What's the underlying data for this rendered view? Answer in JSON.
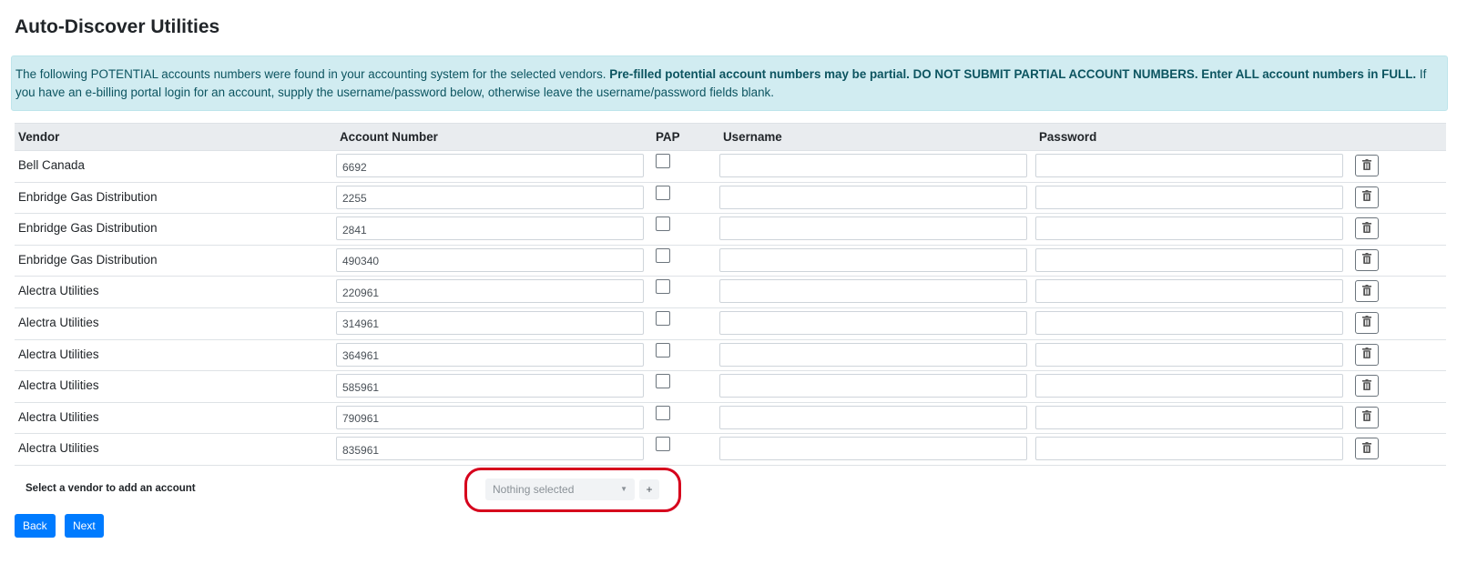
{
  "page": {
    "title": "Auto-Discover Utilities"
  },
  "alert": {
    "text1": "The following POTENTIAL accounts numbers were found in your accounting system for the selected vendors.",
    "bold": "Pre-filled potential account numbers may be partial. DO NOT SUBMIT PARTIAL ACCOUNT NUMBERS. Enter ALL account numbers in FULL.",
    "text2": "If you have an e-billing portal login for an account, supply the username/password below, otherwise leave the username/password fields blank."
  },
  "table": {
    "headers": {
      "vendor": "Vendor",
      "account_number": "Account Number",
      "pap": "PAP",
      "username": "Username",
      "password": "Password"
    },
    "rows": [
      {
        "vendor": "Bell Canada",
        "account": "6692",
        "pap": false,
        "username": "",
        "password": ""
      },
      {
        "vendor": "Enbridge Gas Distribution",
        "account": "2255",
        "pap": false,
        "username": "",
        "password": ""
      },
      {
        "vendor": "Enbridge Gas Distribution",
        "account": "2841",
        "pap": false,
        "username": "",
        "password": ""
      },
      {
        "vendor": "Enbridge Gas Distribution",
        "account": "490340",
        "pap": false,
        "username": "",
        "password": ""
      },
      {
        "vendor": "Alectra Utilities",
        "account": "220961",
        "pap": false,
        "username": "",
        "password": ""
      },
      {
        "vendor": "Alectra Utilities",
        "account": "314961",
        "pap": false,
        "username": "",
        "password": ""
      },
      {
        "vendor": "Alectra Utilities",
        "account": "364961",
        "pap": false,
        "username": "",
        "password": ""
      },
      {
        "vendor": "Alectra Utilities",
        "account": "585961",
        "pap": false,
        "username": "",
        "password": ""
      },
      {
        "vendor": "Alectra Utilities",
        "account": "790961",
        "pap": false,
        "username": "",
        "password": ""
      },
      {
        "vendor": "Alectra Utilities",
        "account": "835961",
        "pap": false,
        "username": "",
        "password": ""
      }
    ],
    "delete_icon": "trash-icon"
  },
  "add_account": {
    "label": "Select a vendor to add an account",
    "select_value": "Nothing selected",
    "add_label": "+"
  },
  "buttons": {
    "back": "Back",
    "next": "Next"
  },
  "colors": {
    "accent": "#007bff",
    "alert_bg": "#d1ecf1",
    "alert_text": "#0c5460",
    "highlight": "#d6001c"
  }
}
